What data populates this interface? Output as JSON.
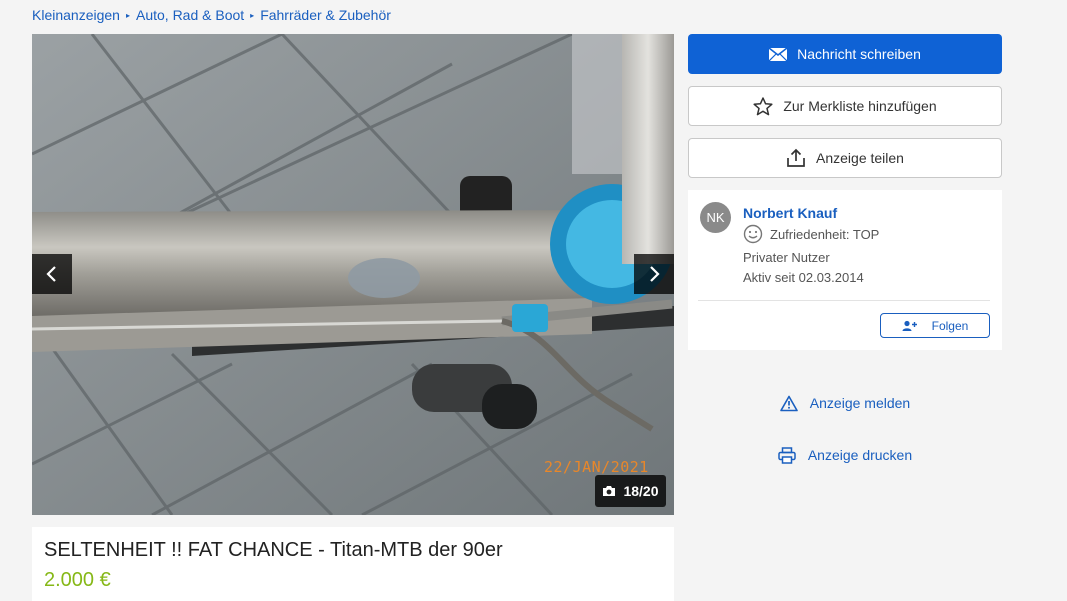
{
  "breadcrumb": {
    "items": [
      "Kleinanzeigen",
      "Auto, Rad & Boot",
      "Fahrräder & Zubehör"
    ],
    "separator": "▸"
  },
  "gallery": {
    "photo_date": "22/JAN/2021",
    "counter": "18/20",
    "icons": {
      "prev": "chevron-left-icon",
      "next": "chevron-right-icon",
      "camera": "camera-icon"
    }
  },
  "listing": {
    "title": "SELTENHEIT !! FAT CHANCE - Titan-MTB der 90er",
    "price": "2.000 €",
    "price_color": "#86b817"
  },
  "actions": {
    "message_label": "Nachricht schreiben",
    "watchlist_label": "Zur Merkliste hinzufügen",
    "share_label": "Anzeige teilen",
    "report_label": "Anzeige melden",
    "print_label": "Anzeige drucken"
  },
  "seller": {
    "initials": "NK",
    "name": "Norbert Knauf",
    "satisfaction": "Zufriedenheit: TOP",
    "type": "Privater Nutzer",
    "active_since": "Aktiv seit 02.03.2014",
    "follow_label": "Folgen"
  },
  "colors": {
    "primary": "#0f62d5",
    "link": "#1a5fbf",
    "background": "#f4f4f4"
  }
}
